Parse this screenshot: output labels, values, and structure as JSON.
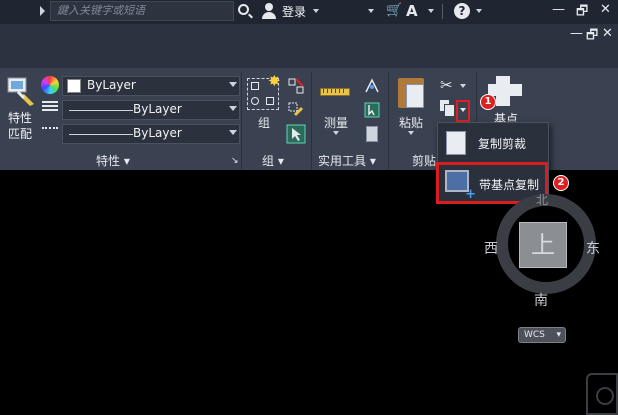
{
  "titlebar": {
    "search_placeholder": "鍵入关键字或短语",
    "login_label": "登录",
    "window_controls": {
      "minimize": "—",
      "restore": "🗗",
      "close": "✕"
    }
  },
  "ribbon": {
    "properties": {
      "match_label": "特性\n匹配",
      "color_value": "ByLayer",
      "linetype_value": "ByLayer",
      "lineweight_value": "ByLayer",
      "panel_label": "特性 ▾"
    },
    "groups": {
      "group_label": "组",
      "panel_label": "组 ▾"
    },
    "utilities": {
      "measure_label": "测量",
      "panel_label": "实用工具 ▾"
    },
    "clipboard": {
      "paste_label": "粘贴",
      "panel_label": "剪贴"
    },
    "hidden_tool_label": "基点"
  },
  "clipboard_menu": {
    "items": [
      {
        "label": "复制剪裁"
      },
      {
        "label": "带基点复制"
      }
    ]
  },
  "annotations": {
    "badge_1": "1",
    "badge_2": "2"
  },
  "viewcube": {
    "top_face": "上",
    "north": "北",
    "south": "南",
    "east": "东",
    "west": "西",
    "ucs_label": "WCS"
  },
  "icons": [
    "search-icon",
    "user-icon",
    "cart-icon",
    "autodesk-icon",
    "help-icon",
    "match-properties-icon",
    "color-wheel-icon",
    "group-icon",
    "measure-icon",
    "calculator-icon",
    "paste-icon",
    "cut-icon",
    "copy-icon",
    "copy-clip-icon",
    "copy-base-point-icon",
    "navigation-icon"
  ]
}
